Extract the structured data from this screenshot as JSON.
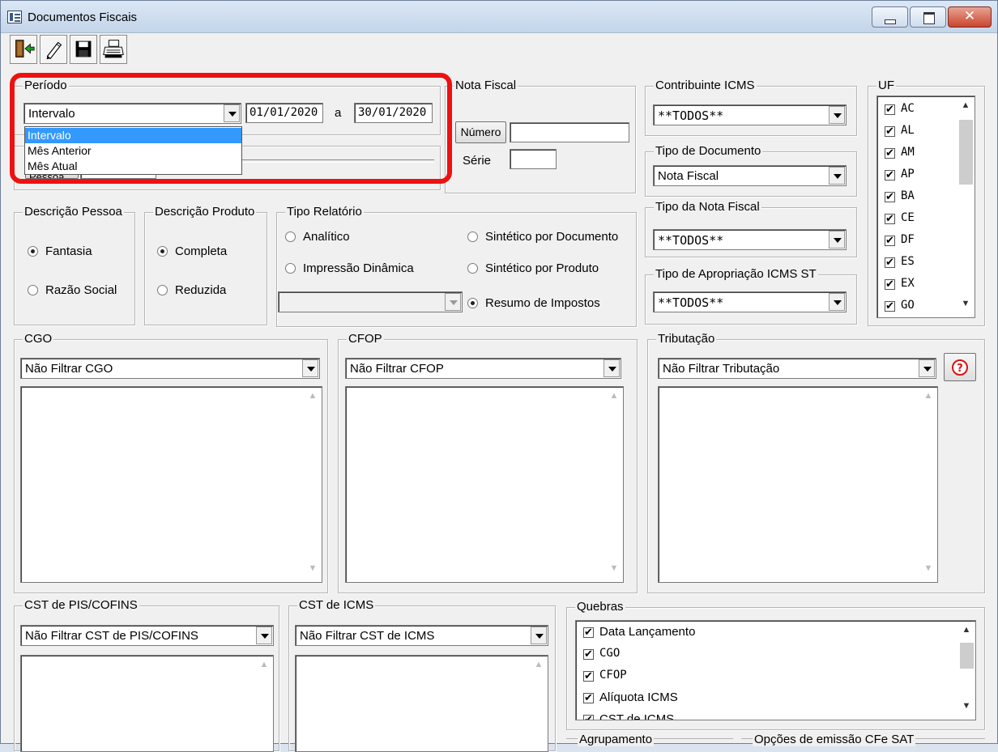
{
  "window": {
    "title": "Documentos Fiscais"
  },
  "toolbar": {
    "buttons": [
      {
        "name": "exit-button",
        "icon": "exit-door-icon"
      },
      {
        "name": "clear-button",
        "icon": "pencil-eraser-icon"
      },
      {
        "name": "save-button",
        "icon": "floppy-disk-icon"
      },
      {
        "name": "print-button",
        "icon": "printer-icon"
      }
    ]
  },
  "periodo": {
    "legend": "Período",
    "selected": "Intervalo",
    "date_from": "01/01/2020",
    "sep": "a",
    "date_to": "30/01/2020",
    "options": [
      "Intervalo",
      "Mês Anterior",
      "Mês Atual"
    ],
    "hidden_button_fragment": "Pessoa"
  },
  "nota_fiscal": {
    "legend": "Nota Fiscal",
    "numero_label": "Número",
    "numero_value": "",
    "serie_label": "Série",
    "serie_value": ""
  },
  "contribuinte": {
    "legend": "Contribuinte ICMS",
    "selected": "**TODOS**"
  },
  "tipo_documento": {
    "legend": "Tipo de Documento",
    "selected": "Nota Fiscal"
  },
  "tipo_nota": {
    "legend": "Tipo da Nota Fiscal",
    "selected": "**TODOS**"
  },
  "tipo_apropriacao": {
    "legend": "Tipo de Apropriação ICMS ST",
    "selected": "**TODOS**"
  },
  "uf": {
    "legend": "UF",
    "items": [
      "AC",
      "AL",
      "AM",
      "AP",
      "BA",
      "CE",
      "DF",
      "ES",
      "EX",
      "GO"
    ]
  },
  "descricao_pessoa": {
    "legend": "Descrição Pessoa",
    "options": [
      "Fantasia",
      "Razão Social"
    ],
    "selected_index": 0
  },
  "descricao_produto": {
    "legend": "Descrição Produto",
    "options": [
      "Completa",
      "Reduzida"
    ],
    "selected_index": 0
  },
  "tipo_relatorio": {
    "legend": "Tipo Relatório",
    "analitico": "Analítico",
    "impressao": "Impressão Dinâmica",
    "sint_doc": "Sintético por Documento",
    "sint_prod": "Sintético por Produto",
    "resumo": "Resumo de Impostos",
    "selected": "Resumo de Impostos"
  },
  "cgo": {
    "legend": "CGO",
    "selected": "Não Filtrar CGO"
  },
  "cfop": {
    "legend": "CFOP",
    "selected": "Não Filtrar CFOP"
  },
  "tributacao": {
    "legend": "Tributação",
    "selected": "Não Filtrar Tributação",
    "help_icon": "help-question-icon"
  },
  "cst_pis": {
    "legend": "CST de PIS/COFINS",
    "selected": "Não Filtrar CST de PIS/COFINS"
  },
  "cst_icms": {
    "legend": "CST de ICMS",
    "selected": "Não Filtrar CST de ICMS"
  },
  "quebras": {
    "legend": "Quebras",
    "items": [
      "Data Lançamento",
      "CGO",
      "CFOP",
      "Alíquota ICMS",
      "CST de ICMS"
    ]
  },
  "bottom": {
    "agrupamento": "Agrupamento",
    "opcoes": "Opções de emissão CFe SAT"
  },
  "colors": {
    "highlight": "#ee1111",
    "selection": "#3399ff",
    "help": "#dd1111"
  }
}
